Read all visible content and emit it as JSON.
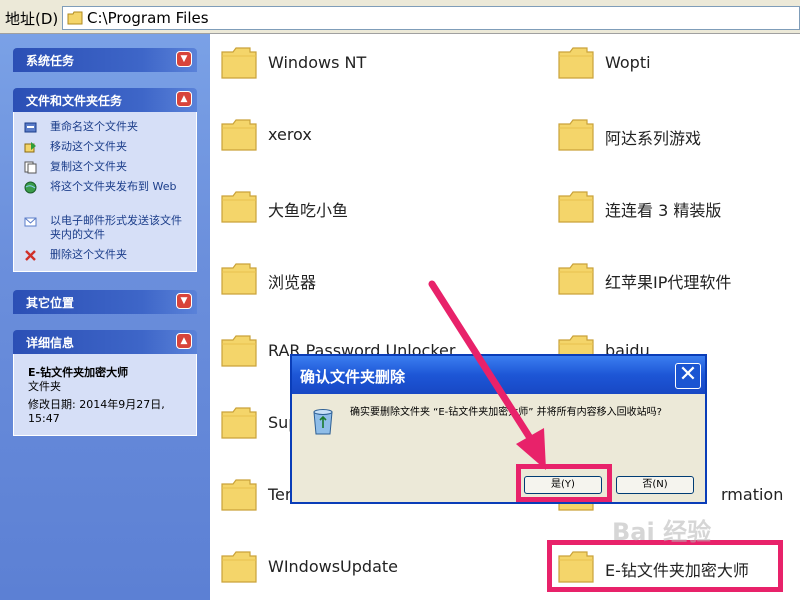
{
  "address_bar": {
    "label": "地址(D)",
    "path": "C:\\Program Files"
  },
  "left_panels": {
    "system_tasks": {
      "title": "系统任务"
    },
    "file_folder_tasks": {
      "title": "文件和文件夹任务",
      "items": [
        {
          "label": "重命名这个文件夹",
          "icon": "rename-icon"
        },
        {
          "label": "移动这个文件夹",
          "icon": "move-icon"
        },
        {
          "label": "复制这个文件夹",
          "icon": "copy-icon"
        },
        {
          "label": "将这个文件夹发布到 Web",
          "icon": "publish-web-icon"
        },
        {
          "label": "以电子邮件形式发送该文件夹内的文件",
          "icon": "email-icon"
        },
        {
          "label": "删除这个文件夹",
          "icon": "delete-icon"
        }
      ]
    },
    "other_places": {
      "title": "其它位置"
    },
    "details": {
      "title": "详细信息",
      "name": "E-钻文件夹加密大师",
      "type": "文件夹",
      "modified": "修改日期: 2014年9月27日, 15:47"
    }
  },
  "folders": [
    {
      "name": "Windows NT"
    },
    {
      "name": "Wopti"
    },
    {
      "name": "xerox"
    },
    {
      "name": "阿达系列游戏"
    },
    {
      "name": "大鱼吃小鱼"
    },
    {
      "name": "连连看 3 精装版"
    },
    {
      "name": "浏览器"
    },
    {
      "name": "红苹果IP代理软件"
    },
    {
      "name": "RAR Password Unlocker"
    },
    {
      "name": "baidu"
    },
    {
      "name": "Sup"
    },
    {
      "name": ""
    },
    {
      "name": "Ter"
    },
    {
      "name": "rmation"
    },
    {
      "name": "WIndowsUpdate"
    },
    {
      "name": "E-钻文件夹加密大师"
    }
  ],
  "dialog": {
    "title": "确认文件夹删除",
    "message": "确实要删除文件夹 “E-钻文件夹加密大师” 并将所有内容移入回收站吗?",
    "yes_label": "是(Y)",
    "no_label": "否(N)"
  },
  "watermark": "Bai 经验",
  "colors": {
    "highlight": "#e8226a",
    "folder": "#f4d56a",
    "titlebar": "#1d56d6"
  }
}
